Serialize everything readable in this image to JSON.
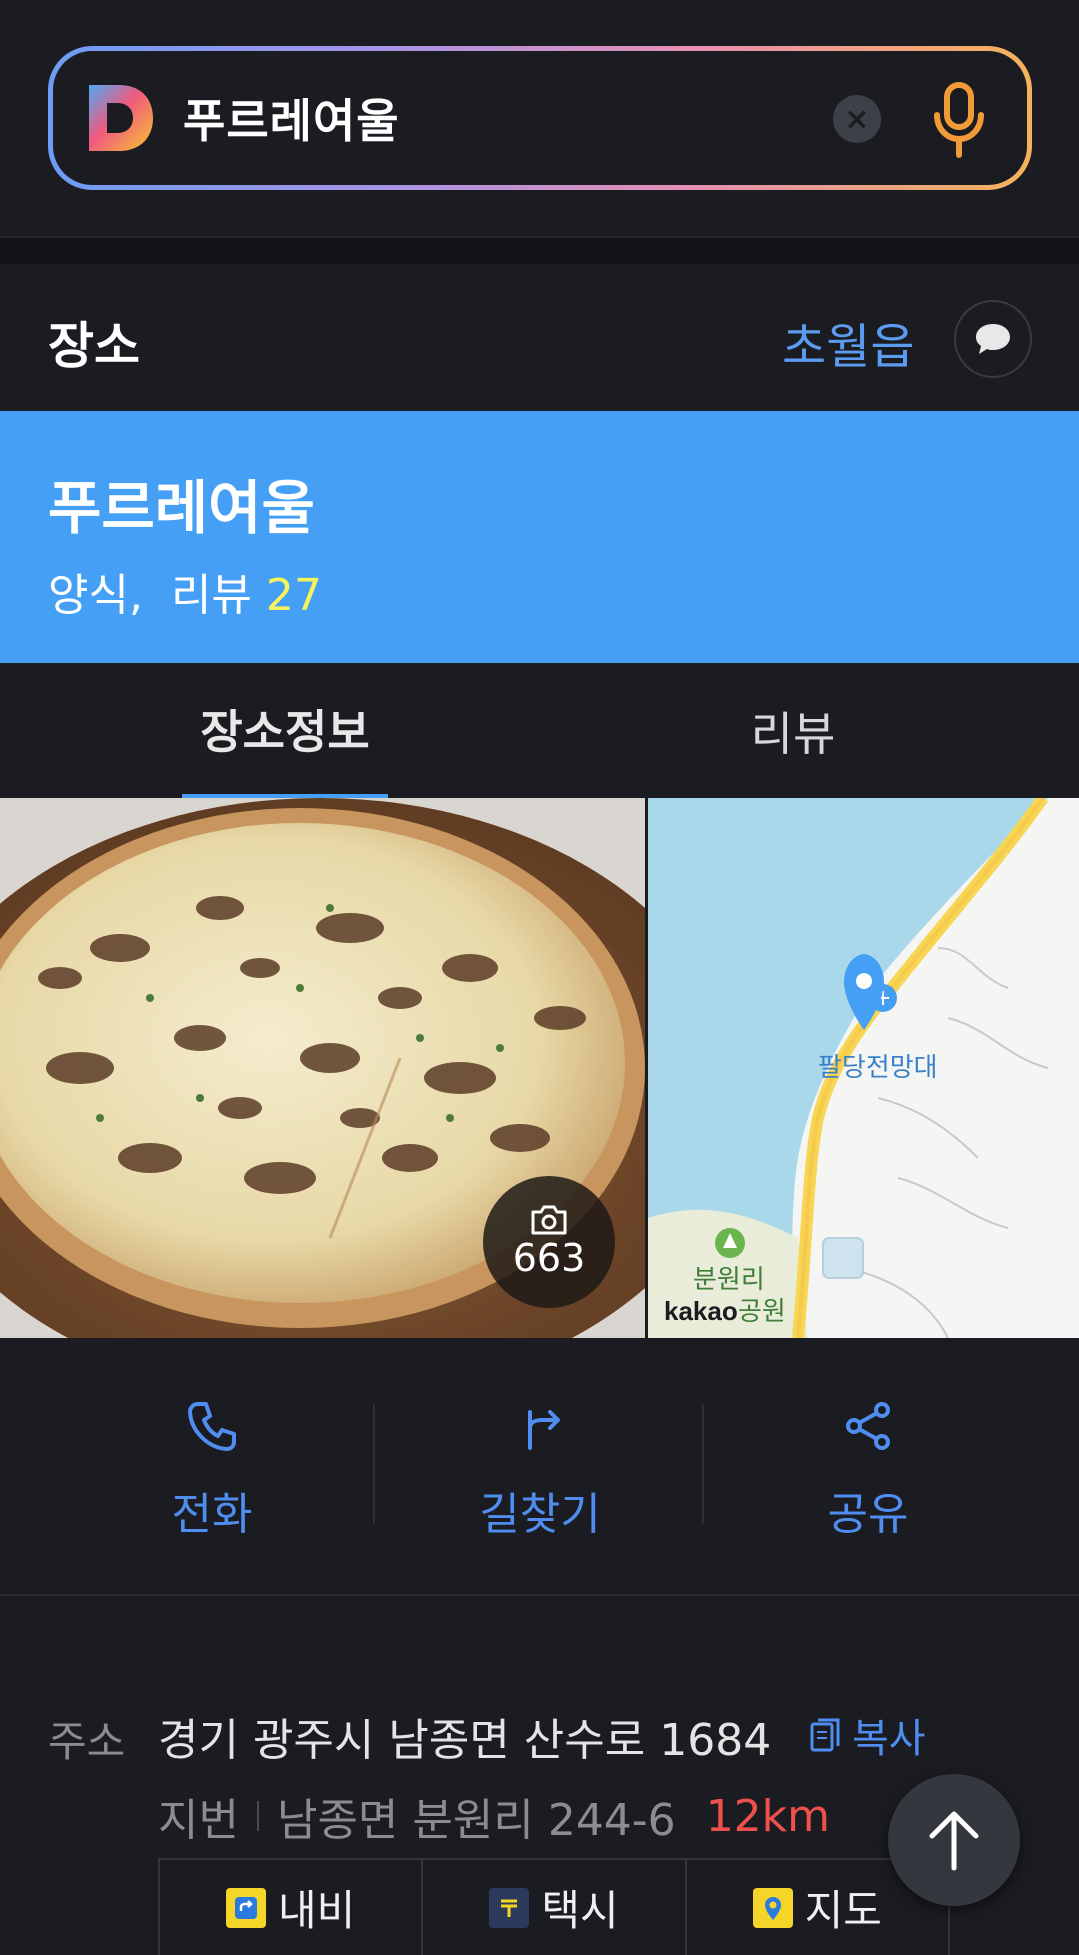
{
  "search": {
    "query": "푸르레여울"
  },
  "section": {
    "label": "장소",
    "region": "초월읍"
  },
  "place": {
    "name": "푸르레여울",
    "category": "양식,",
    "review_label": "리뷰",
    "review_count": "27"
  },
  "tabs": [
    {
      "label": "장소정보",
      "active": true
    },
    {
      "label": "리뷰",
      "active": false
    }
  ],
  "photo": {
    "count": "663"
  },
  "map": {
    "landmark": "팔당전망대",
    "park": "분원리",
    "park2": "공원",
    "watermark": "kakao"
  },
  "actions": [
    {
      "label": "전화",
      "icon": "phone-icon"
    },
    {
      "label": "길찾기",
      "icon": "directions-icon"
    },
    {
      "label": "공유",
      "icon": "share-icon"
    }
  ],
  "address": {
    "label": "주소",
    "road": "경기 광주시 남종면 산수로 1684",
    "copy_label": "복사",
    "jibun_label": "지번",
    "jibun": "남종면 분원리 244-6",
    "distance": "12km"
  },
  "links": [
    {
      "label": "내비",
      "icon": "navi-icon"
    },
    {
      "label": "택시",
      "icon": "taxi-icon"
    },
    {
      "label": "지도",
      "icon": "map-pin-icon"
    }
  ],
  "colors": {
    "accent": "#459ff5",
    "link_blue": "#4f8df0",
    "distance_red": "#f0504b",
    "count_yellow": "#f7f35a"
  }
}
